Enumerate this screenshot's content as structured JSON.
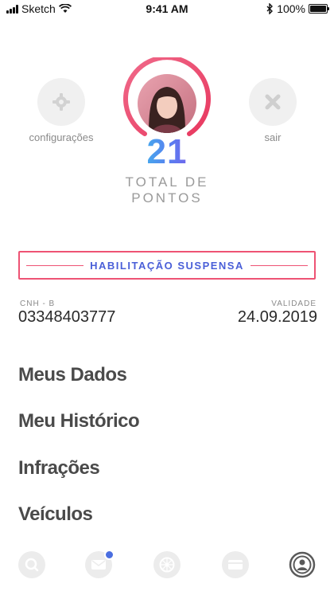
{
  "status_bar": {
    "carrier": "Sketch",
    "time": "9:41 AM",
    "battery": "100%",
    "battery_level": 1.0
  },
  "profile": {
    "left_button_label": "configurações",
    "right_button_label": "sair",
    "total_points": "21",
    "total_points_label": "TOTAL DE\nPONTOS"
  },
  "license": {
    "status": "HABILITAÇÃO SUSPENSA",
    "cnh_label": "CNH - B",
    "cnh_number": "03348403777",
    "validity_label": "VALIDADE",
    "validity_date": "24.09.2019"
  },
  "menu": [
    {
      "label": "Meus Dados"
    },
    {
      "label": "Meu Histórico"
    },
    {
      "label": "Infrações"
    },
    {
      "label": "Veículos"
    }
  ],
  "tabs": [
    {
      "icon": "search-icon"
    },
    {
      "icon": "mail-icon"
    },
    {
      "icon": "steering-wheel-icon"
    },
    {
      "icon": "wallet-icon"
    },
    {
      "icon": "profile-icon",
      "active": true
    }
  ],
  "colors": {
    "accent_pink": "#ee5374",
    "accent_blue": "#4a5fd8"
  }
}
